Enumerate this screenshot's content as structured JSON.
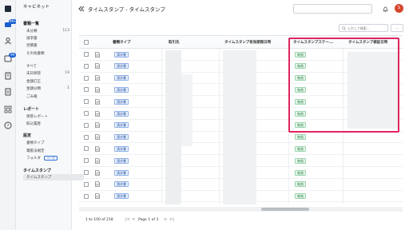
{
  "sidebar": {
    "title": "キャビネット",
    "sections": [
      {
        "heading": "書類一覧"
      },
      {
        "heading": "レポート"
      },
      {
        "heading": "設定"
      },
      {
        "heading": "タイムスタンプ"
      }
    ],
    "doc_items": [
      {
        "label": "未分類",
        "count": "113"
      },
      {
        "label": "請求書",
        "count": ""
      },
      {
        "label": "見積書",
        "count": ""
      },
      {
        "label": "その他書類",
        "count": ""
      }
    ],
    "status_items": [
      {
        "label": "すべて",
        "count": ""
      },
      {
        "label": "未日保管",
        "count": "19"
      },
      {
        "label": "金額訂正",
        "count": ""
      },
      {
        "label": "金額分類",
        "count": "1"
      },
      {
        "label": "ごみ箱",
        "count": ""
      }
    ],
    "report_items": [
      {
        "label": "保管レポート"
      },
      {
        "label": "取込履歴"
      }
    ],
    "settings_items": [
      {
        "label": "書類タイプ"
      },
      {
        "label": "電帳法規定"
      },
      {
        "label": "フォルダ",
        "tag": "ベータ"
      }
    ],
    "timestamp_items": [
      {
        "label": "タイムスタンプ"
      }
    ],
    "rail_badges": [
      "99+",
      "99"
    ]
  },
  "header": {
    "title": "タイムスタンプ - タイムスタンプ",
    "avatar_initial": "S"
  },
  "toolbar": {
    "search_placeholder": "入力して検索...",
    "filter_label": "···"
  },
  "table": {
    "columns": [
      "書類タイプ",
      "取引先",
      "タイムスタンプ有効期限日時",
      "タイムスタンプステー...",
      "タイムスタンプ検証日時"
    ],
    "rows": [
      {
        "doc_type": "請求書",
        "status": "有効"
      },
      {
        "doc_type": "請求書",
        "status": "有効"
      },
      {
        "doc_type": "請求書",
        "status": "有効"
      },
      {
        "doc_type": "請求書",
        "status": "有効"
      },
      {
        "doc_type": "請求書",
        "status": "有効"
      },
      {
        "doc_type": "請求書",
        "status": "有効"
      },
      {
        "doc_type": "請求書",
        "status": "有効"
      },
      {
        "doc_type": "請求書",
        "status": "有効"
      },
      {
        "doc_type": "請求書",
        "status": "有効"
      },
      {
        "doc_type": "請求書",
        "status": "有効"
      },
      {
        "doc_type": "請求書",
        "status": "有効"
      },
      {
        "doc_type": "請求書",
        "status": "有効"
      },
      {
        "doc_type": "請求書",
        "status": "有効"
      },
      {
        "doc_type": "請求書",
        "status": "有効"
      }
    ]
  },
  "footer": {
    "range": "1 to 100 of 218",
    "page": "Page 1 of 3",
    "first": "|<",
    "prev": "<",
    "next": ">",
    "last": ">|"
  },
  "colors": {
    "accent": "#1a5fd0",
    "highlight": "#e0245e",
    "status_green": "#1c7a3a",
    "avatar": "#d6452d"
  }
}
